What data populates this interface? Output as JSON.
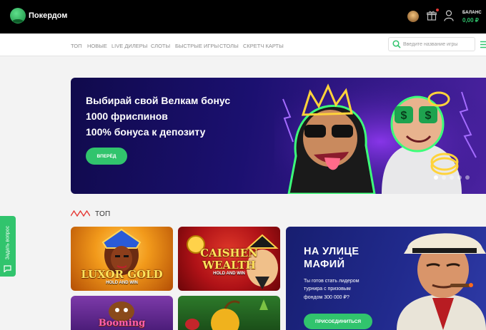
{
  "header": {
    "logo_text": "Покердом",
    "balance_label": "БАЛАНС",
    "balance_value": "0,00 ₽"
  },
  "nav": {
    "items": [
      "ТОП",
      "НОВЫЕ",
      "LIVE ДИЛЕРЫ",
      "СЛОТЫ",
      "БЫСТРЫЕ ИГРЫ",
      "СТОЛЫ",
      "СКРЕТЧ КАРТЫ"
    ],
    "search_placeholder": "Введите название игры"
  },
  "banner": {
    "line1": "Выбирай свой Велкам бонус",
    "line2": "1000 фриспинов",
    "line3": "100% бонуса к депозиту",
    "button": "ВПЕРЁД",
    "slides_total": 5,
    "slide_active": 1
  },
  "section": {
    "title": "ТОП"
  },
  "games": [
    {
      "title": "LUXOR GOLD",
      "subtitle": "HOLD AND WIN"
    },
    {
      "title_line1": "CAISHEN",
      "title_line2": "WEALTH",
      "subtitle": "HOLD AND WIN"
    },
    {
      "title": "Booming"
    },
    {
      "title": ""
    }
  ],
  "promo": {
    "title_line1": "НА УЛИЦЕ",
    "title_line2": "МАФИЙ",
    "text_line1": "Ты готов стать лидером",
    "text_line2": "турнира с призовым",
    "text_line3": "фондом 300 000 ₽?",
    "button": "ПРИСОЕДИНИТЬСЯ"
  },
  "feedback": {
    "label": "Задать вопрос"
  },
  "colors": {
    "accent_green": "#31c46d",
    "header_bg": "#000000",
    "page_bg": "#f3f3f3"
  }
}
